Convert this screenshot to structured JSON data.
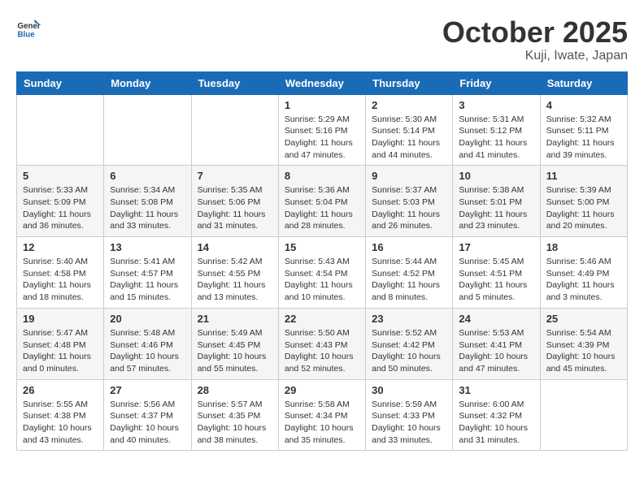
{
  "header": {
    "logo_general": "General",
    "logo_blue": "Blue",
    "month": "October 2025",
    "location": "Kuji, Iwate, Japan"
  },
  "weekdays": [
    "Sunday",
    "Monday",
    "Tuesday",
    "Wednesday",
    "Thursday",
    "Friday",
    "Saturday"
  ],
  "weeks": [
    [
      null,
      null,
      null,
      {
        "day": 1,
        "sunrise": "5:29 AM",
        "sunset": "5:16 PM",
        "daylight": "11 hours and 47 minutes."
      },
      {
        "day": 2,
        "sunrise": "5:30 AM",
        "sunset": "5:14 PM",
        "daylight": "11 hours and 44 minutes."
      },
      {
        "day": 3,
        "sunrise": "5:31 AM",
        "sunset": "5:12 PM",
        "daylight": "11 hours and 41 minutes."
      },
      {
        "day": 4,
        "sunrise": "5:32 AM",
        "sunset": "5:11 PM",
        "daylight": "11 hours and 39 minutes."
      }
    ],
    [
      {
        "day": 5,
        "sunrise": "5:33 AM",
        "sunset": "5:09 PM",
        "daylight": "11 hours and 36 minutes."
      },
      {
        "day": 6,
        "sunrise": "5:34 AM",
        "sunset": "5:08 PM",
        "daylight": "11 hours and 33 minutes."
      },
      {
        "day": 7,
        "sunrise": "5:35 AM",
        "sunset": "5:06 PM",
        "daylight": "11 hours and 31 minutes."
      },
      {
        "day": 8,
        "sunrise": "5:36 AM",
        "sunset": "5:04 PM",
        "daylight": "11 hours and 28 minutes."
      },
      {
        "day": 9,
        "sunrise": "5:37 AM",
        "sunset": "5:03 PM",
        "daylight": "11 hours and 26 minutes."
      },
      {
        "day": 10,
        "sunrise": "5:38 AM",
        "sunset": "5:01 PM",
        "daylight": "11 hours and 23 minutes."
      },
      {
        "day": 11,
        "sunrise": "5:39 AM",
        "sunset": "5:00 PM",
        "daylight": "11 hours and 20 minutes."
      }
    ],
    [
      {
        "day": 12,
        "sunrise": "5:40 AM",
        "sunset": "4:58 PM",
        "daylight": "11 hours and 18 minutes."
      },
      {
        "day": 13,
        "sunrise": "5:41 AM",
        "sunset": "4:57 PM",
        "daylight": "11 hours and 15 minutes."
      },
      {
        "day": 14,
        "sunrise": "5:42 AM",
        "sunset": "4:55 PM",
        "daylight": "11 hours and 13 minutes."
      },
      {
        "day": 15,
        "sunrise": "5:43 AM",
        "sunset": "4:54 PM",
        "daylight": "11 hours and 10 minutes."
      },
      {
        "day": 16,
        "sunrise": "5:44 AM",
        "sunset": "4:52 PM",
        "daylight": "11 hours and 8 minutes."
      },
      {
        "day": 17,
        "sunrise": "5:45 AM",
        "sunset": "4:51 PM",
        "daylight": "11 hours and 5 minutes."
      },
      {
        "day": 18,
        "sunrise": "5:46 AM",
        "sunset": "4:49 PM",
        "daylight": "11 hours and 3 minutes."
      }
    ],
    [
      {
        "day": 19,
        "sunrise": "5:47 AM",
        "sunset": "4:48 PM",
        "daylight": "11 hours and 0 minutes."
      },
      {
        "day": 20,
        "sunrise": "5:48 AM",
        "sunset": "4:46 PM",
        "daylight": "10 hours and 57 minutes."
      },
      {
        "day": 21,
        "sunrise": "5:49 AM",
        "sunset": "4:45 PM",
        "daylight": "10 hours and 55 minutes."
      },
      {
        "day": 22,
        "sunrise": "5:50 AM",
        "sunset": "4:43 PM",
        "daylight": "10 hours and 52 minutes."
      },
      {
        "day": 23,
        "sunrise": "5:52 AM",
        "sunset": "4:42 PM",
        "daylight": "10 hours and 50 minutes."
      },
      {
        "day": 24,
        "sunrise": "5:53 AM",
        "sunset": "4:41 PM",
        "daylight": "10 hours and 47 minutes."
      },
      {
        "day": 25,
        "sunrise": "5:54 AM",
        "sunset": "4:39 PM",
        "daylight": "10 hours and 45 minutes."
      }
    ],
    [
      {
        "day": 26,
        "sunrise": "5:55 AM",
        "sunset": "4:38 PM",
        "daylight": "10 hours and 43 minutes."
      },
      {
        "day": 27,
        "sunrise": "5:56 AM",
        "sunset": "4:37 PM",
        "daylight": "10 hours and 40 minutes."
      },
      {
        "day": 28,
        "sunrise": "5:57 AM",
        "sunset": "4:35 PM",
        "daylight": "10 hours and 38 minutes."
      },
      {
        "day": 29,
        "sunrise": "5:58 AM",
        "sunset": "4:34 PM",
        "daylight": "10 hours and 35 minutes."
      },
      {
        "day": 30,
        "sunrise": "5:59 AM",
        "sunset": "4:33 PM",
        "daylight": "10 hours and 33 minutes."
      },
      {
        "day": 31,
        "sunrise": "6:00 AM",
        "sunset": "4:32 PM",
        "daylight": "10 hours and 31 minutes."
      },
      null
    ]
  ]
}
